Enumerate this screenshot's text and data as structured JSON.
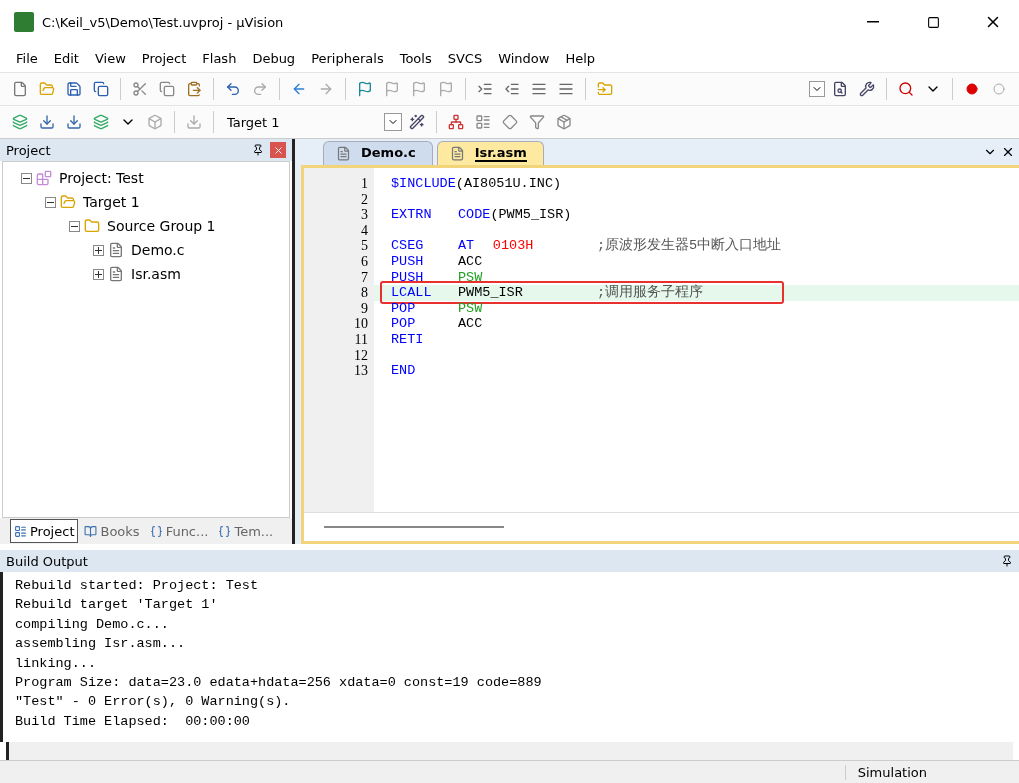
{
  "window": {
    "title": "C:\\Keil_v5\\Demo\\Test.uvproj - µVision"
  },
  "menu": [
    "File",
    "Edit",
    "View",
    "Project",
    "Flash",
    "Debug",
    "Peripherals",
    "Tools",
    "SVCS",
    "Window",
    "Help"
  ],
  "target_select": {
    "value": "Target 1"
  },
  "project_panel": {
    "title": "Project",
    "tree": [
      {
        "label": "Project: Test",
        "kind": "project",
        "expanded": true,
        "children": [
          {
            "label": "Target 1",
            "kind": "target",
            "expanded": true,
            "children": [
              {
                "label": "Source Group 1",
                "kind": "group",
                "expanded": true,
                "children": [
                  {
                    "label": "Demo.c",
                    "kind": "file",
                    "expanded": false
                  },
                  {
                    "label": "Isr.asm",
                    "kind": "file",
                    "expanded": false
                  }
                ]
              }
            ]
          }
        ]
      }
    ],
    "tabs": [
      {
        "label": "Project",
        "kind": "project",
        "selected": true
      },
      {
        "label": "Books",
        "kind": "books",
        "selected": false
      },
      {
        "label": "Func...",
        "kind": "functions",
        "selected": false
      },
      {
        "label": "Tem...",
        "kind": "templates",
        "selected": false
      }
    ]
  },
  "editor": {
    "tabs": [
      {
        "label": "Demo.c",
        "selected": false
      },
      {
        "label": "Isr.asm",
        "selected": true
      }
    ],
    "lines": [
      {
        "number": "1",
        "highlighted": false,
        "columns": [
          [
            {
              "kind": "keyword",
              "text": "$INCLUDE"
            },
            {
              "kind": "plain",
              "text": "(AI8051U.INC)",
              "joined": true
            }
          ]
        ]
      },
      {
        "number": "2",
        "highlighted": false
      },
      {
        "number": "3",
        "highlighted": false,
        "columns": [
          [
            {
              "kind": "keyword",
              "text": "EXTRN"
            }
          ],
          [
            {
              "kind": "keyword",
              "text": "CODE"
            },
            {
              "kind": "plain",
              "text": "(PWM5_ISR)",
              "joined": true
            }
          ]
        ]
      },
      {
        "number": "4",
        "highlighted": false
      },
      {
        "number": "5",
        "highlighted": false,
        "columns": [
          [
            {
              "kind": "keyword",
              "text": "CSEG"
            }
          ],
          [
            {
              "kind": "keyword",
              "text": "AT"
            },
            {
              "kind": "number",
              "text": "0103H",
              "joined": false
            }
          ],
          [
            {
              "kind": "comment",
              "text": ";原波形发生器5中断入口地址"
            }
          ]
        ]
      },
      {
        "number": "6",
        "highlighted": false,
        "columns": [
          [
            {
              "kind": "keyword",
              "text": "PUSH"
            }
          ],
          [
            {
              "kind": "plain",
              "text": "ACC"
            }
          ]
        ]
      },
      {
        "number": "7",
        "highlighted": false,
        "columns": [
          [
            {
              "kind": "keyword",
              "text": "PUSH"
            }
          ],
          [
            {
              "kind": "register",
              "text": "PSW"
            }
          ]
        ]
      },
      {
        "number": "8",
        "highlighted": true,
        "columns": [
          [
            {
              "kind": "keyword",
              "text": "LCALL"
            }
          ],
          [
            {
              "kind": "plain",
              "text": "PWM5_ISR"
            }
          ],
          [
            {
              "kind": "comment",
              "text": ";调用服务子程序"
            }
          ]
        ]
      },
      {
        "number": "9",
        "highlighted": false,
        "columns": [
          [
            {
              "kind": "keyword",
              "text": "POP"
            }
          ],
          [
            {
              "kind": "register",
              "text": "PSW"
            }
          ]
        ]
      },
      {
        "number": "10",
        "highlighted": false,
        "columns": [
          [
            {
              "kind": "keyword",
              "text": "POP"
            }
          ],
          [
            {
              "kind": "plain",
              "text": "ACC"
            }
          ]
        ]
      },
      {
        "number": "11",
        "highlighted": false,
        "columns": [
          [
            {
              "kind": "keyword",
              "text": "RETI"
            }
          ]
        ]
      },
      {
        "number": "12",
        "highlighted": false
      },
      {
        "number": "13",
        "highlighted": false,
        "columns": [
          [
            {
              "kind": "keyword",
              "text": "END"
            }
          ]
        ]
      }
    ]
  },
  "build_output": {
    "title": "Build Output",
    "lines": [
      "Rebuild started: Project: Test",
      "Rebuild target 'Target 1'",
      "compiling Demo.c...",
      "assembling Isr.asm...",
      "linking...",
      "Program Size: data=23.0 edata+hdata=256 xdata=0 const=19 code=889",
      "\"Test\" - 0 Error(s), 0 Warning(s).",
      "Build Time Elapsed:  00:00:00"
    ]
  },
  "status_bar": {
    "mode": "Simulation"
  }
}
